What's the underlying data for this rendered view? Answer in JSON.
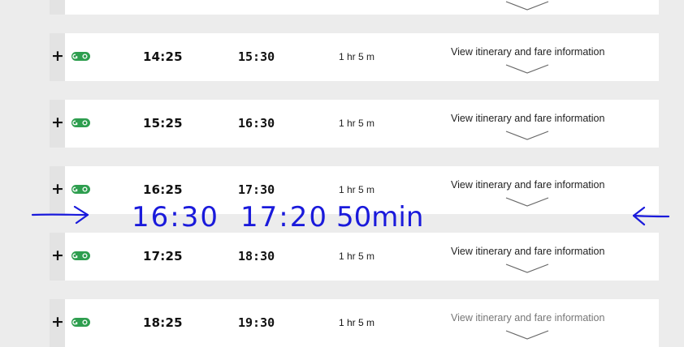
{
  "trips": [
    {
      "expand": "+",
      "departure": "",
      "arrival": "",
      "duration": "",
      "link": ""
    },
    {
      "expand": "+",
      "departure": "14:25",
      "arrival": "15:30",
      "duration": "1 hr 5 m",
      "link": "View itinerary and fare information"
    },
    {
      "expand": "+",
      "departure": "15:25",
      "arrival": "16:30",
      "duration": "1 hr 5 m",
      "link": "View itinerary and fare information"
    },
    {
      "expand": "+",
      "departure": "16:25",
      "arrival": "17:30",
      "duration": "1 hr 5 m",
      "link": "View itinerary and fare information"
    },
    {
      "expand": "+",
      "departure": "17:25",
      "arrival": "18:30",
      "duration": "1 hr 5 m",
      "link": "View itinerary and fare information"
    },
    {
      "expand": "+",
      "departure": "18:25",
      "arrival": "19:30",
      "duration": "1 hr 5 m",
      "link": "View itinerary and fare information"
    }
  ],
  "handwritten": {
    "departure": "16:30",
    "arrival": "17:20",
    "duration": "50min",
    "color": "#1a1adb"
  },
  "colors": {
    "go_logo": "#2e9e4f",
    "row_background": "#ffffff",
    "page_background": "#ececec"
  },
  "icons": {
    "operator": "go-transit-logo-icon",
    "expand": "plus-icon",
    "details": "chevron-down-icon"
  }
}
